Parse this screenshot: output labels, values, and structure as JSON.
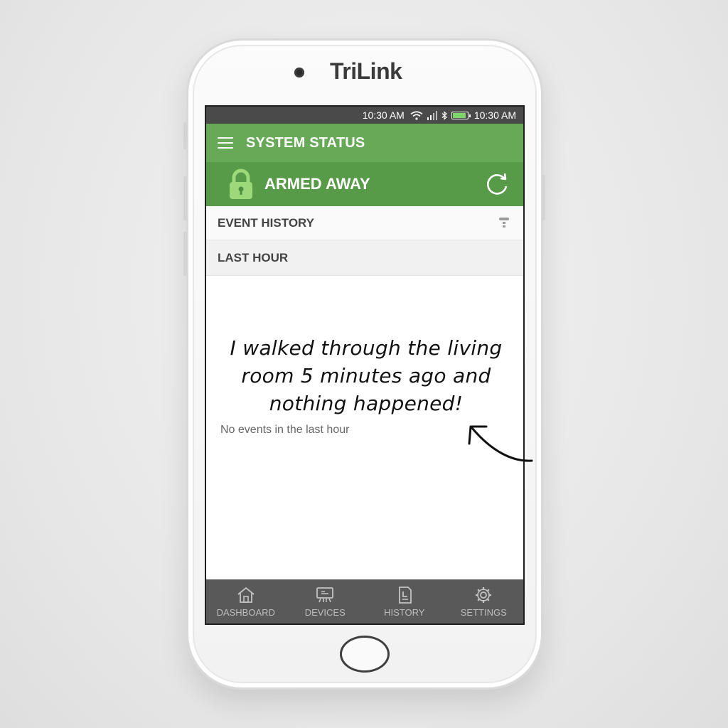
{
  "device": {
    "brand": "TriLink"
  },
  "statusbar": {
    "time_left": "10:30 AM",
    "time_right": "10:30 AM",
    "icons": [
      "wifi-icon",
      "signal-icon",
      "bluetooth-icon",
      "battery-icon"
    ]
  },
  "header": {
    "menu_icon": "hamburger-menu-icon",
    "title": "SYSTEM STATUS"
  },
  "system": {
    "state": "ARMED AWAY",
    "state_icon": "lock-icon",
    "refresh_icon": "refresh-icon"
  },
  "events": {
    "section_title": "EVENT HISTORY",
    "filter_icon": "filter-icon",
    "group_label": "LAST HOUR",
    "empty_message": "No events in the last hour"
  },
  "annotation": {
    "line1": "I walked through the living",
    "line2": "room 5 minutes ago and",
    "line3": "nothing happened!"
  },
  "nav": {
    "items": [
      {
        "label": "DASHBOARD",
        "icon": "home-icon"
      },
      {
        "label": "DEVICES",
        "icon": "devices-icon"
      },
      {
        "label": "HISTORY",
        "icon": "history-icon"
      },
      {
        "label": "SETTINGS",
        "icon": "gear-icon"
      }
    ]
  },
  "colors": {
    "header_green": "#67a957",
    "armed_green": "#579a47",
    "nav_bg": "#595959",
    "status_bg": "#4a4a4a"
  }
}
